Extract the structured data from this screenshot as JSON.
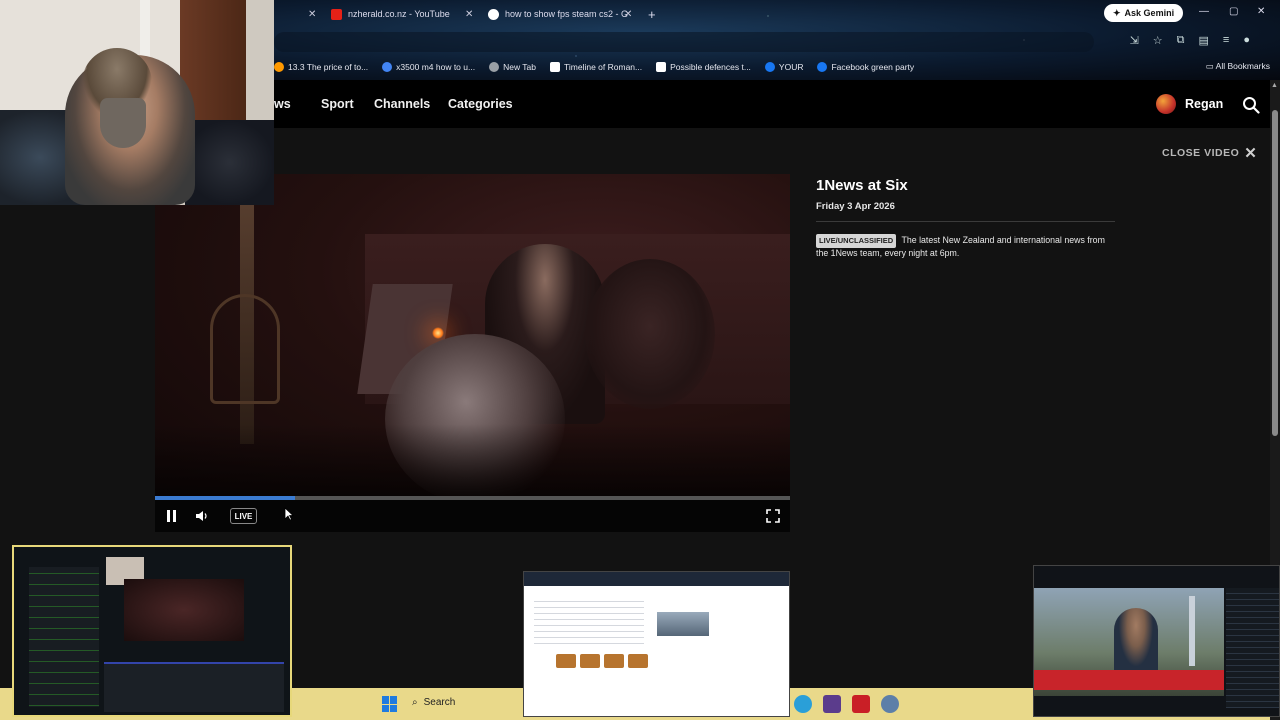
{
  "browser": {
    "tabs": [
      {
        "title": "nzherald.co.nz - YouTube",
        "fav_color": "#e62117"
      },
      {
        "title": "how to show fps steam cs2 - G",
        "fav_color": "#ffffff"
      }
    ],
    "ask_gemini": "Ask Gemini",
    "bookmarks": [
      {
        "label": "13.3 The price of to...",
        "color": "#ff9900"
      },
      {
        "label": "x3500 m4 how to u...",
        "color": "#4285f4"
      },
      {
        "label": "New Tab",
        "color": "#9aa0a6"
      },
      {
        "label": "Timeline of Roman...",
        "color": "#ffffff"
      },
      {
        "label": "Possible defences t...",
        "color": "#ffffff"
      },
      {
        "label": "YOUR",
        "color": "#1877f2"
      },
      {
        "label": "Facebook green party",
        "color": "#1877f2"
      }
    ],
    "all_bookmarks": "All Bookmarks"
  },
  "nav": {
    "links": [
      "News",
      "Sport",
      "Channels",
      "Categories"
    ],
    "user": "Regan"
  },
  "player": {
    "close_label": "CLOSE VIDEO",
    "live_label": "LIVE",
    "progress": 0.22,
    "accent": "#3b7bd1"
  },
  "show": {
    "title": "1News at Six",
    "date": "Friday 3 Apr 2026",
    "classification": "LIVE/UNCLASSIFIED",
    "description": "The latest New Zealand and international news from the 1News team, every night at 6pm."
  },
  "taskbar": {
    "search": "Search",
    "color": "#e9d98a"
  }
}
